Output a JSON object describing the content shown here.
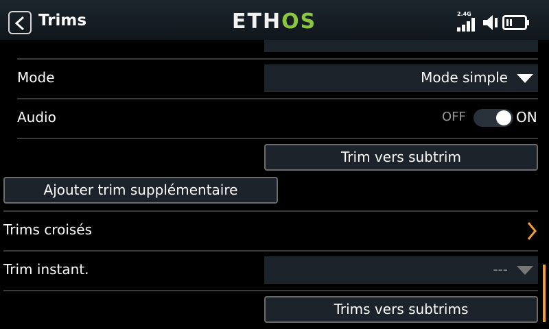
{
  "header": {
    "title": "Trims",
    "logo_part1": "ETH",
    "logo_part2": "OS",
    "signal_label": "2.4G"
  },
  "rows": {
    "mode": {
      "label": "Mode",
      "value": "Mode simple"
    },
    "audio": {
      "label": "Audio",
      "off_label": "OFF",
      "on_label": "ON",
      "state": "on"
    },
    "trim_to_subtrim_button": "Trim vers subtrim",
    "add_extra_trim_button": "Ajouter trim supplémentaire",
    "cross_trims": {
      "label": "Trims croisés"
    },
    "instant_trim": {
      "label": "Trim instant.",
      "value": "---"
    },
    "trims_to_subtrims_button": "Trims vers subtrims"
  },
  "colors": {
    "accent": "#f0a030",
    "logo_green": "#8cc63f",
    "field_bg": "#1c232a"
  }
}
